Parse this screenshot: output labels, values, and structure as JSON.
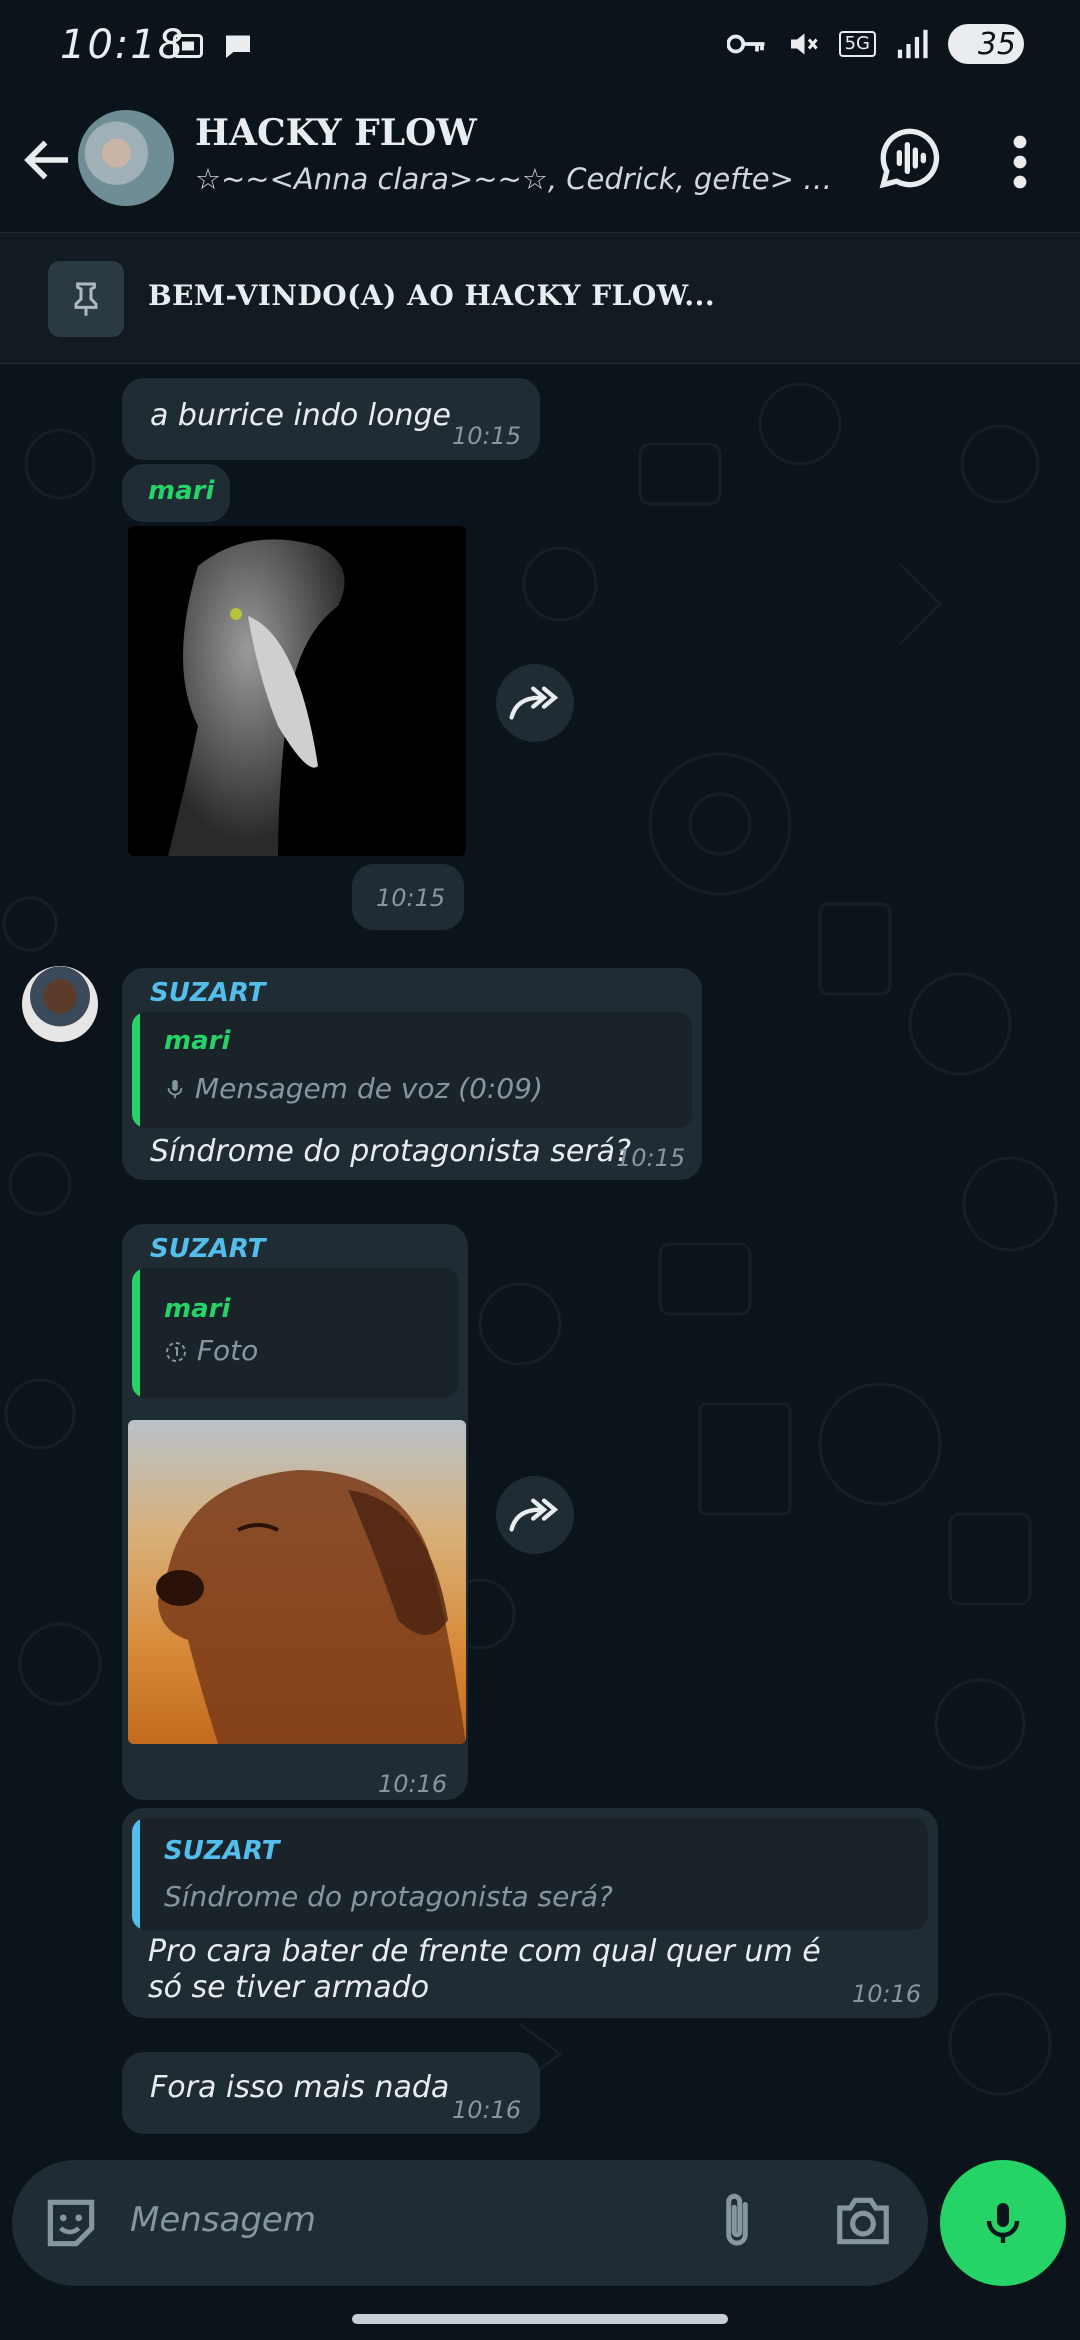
{
  "status": {
    "time": "10:18",
    "network": "5G",
    "battery": "35"
  },
  "header": {
    "title": "HACKY FLOW",
    "subtitle": "☆~~<Anna clara>~~☆, Cedrick, gefte> n..."
  },
  "pinned": {
    "text": "BEM-VINDO(A) AO HACKY FLOW..."
  },
  "messages": {
    "m1": {
      "text": "a burrice indo longe",
      "time": "10:15"
    },
    "m2": {
      "sender": "mari",
      "time": "10:15"
    },
    "m3": {
      "sender": "SUZART",
      "quote_name": "mari",
      "quote_text": "Mensagem de voz (0:09)",
      "text": "Síndrome do protagonista será?",
      "time": "10:15"
    },
    "m4": {
      "sender": "SUZART",
      "quote_name": "mari",
      "quote_text": "Foto",
      "time": "10:16"
    },
    "m5": {
      "quote_name": "SUZART",
      "quote_text": "Síndrome do protagonista será?",
      "text": "Pro cara bater de frente com qual quer um é só se tiver armado",
      "time": "10:16"
    },
    "m6": {
      "text": "Fora isso mais nada",
      "time": "10:16"
    }
  },
  "composer": {
    "placeholder": "Mensagem"
  },
  "colors": {
    "background": "#0b141a",
    "bubble": "#202c33",
    "accent_green": "#25d366",
    "sender_mari": "#25d366",
    "sender_suzart": "#53bdeb"
  },
  "icons": [
    "back-arrow-icon",
    "voice-chat-icon",
    "more-icon",
    "pin-icon",
    "forward-icon",
    "mic-icon",
    "sticker-icon",
    "attach-icon",
    "camera-icon"
  ]
}
